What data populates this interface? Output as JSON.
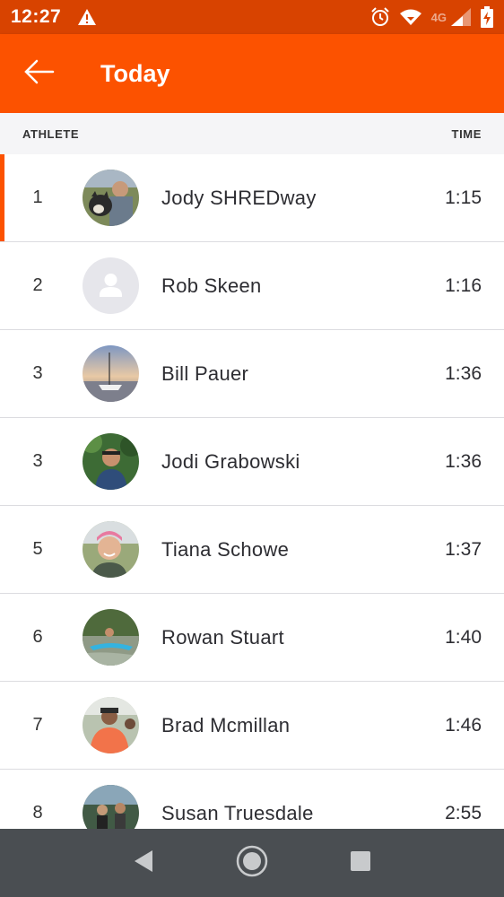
{
  "status_bar": {
    "time": "12:27",
    "network": "4G",
    "icons": [
      "warning-icon",
      "alarm-icon",
      "wifi-icon",
      "signal-icon",
      "battery-charging-icon"
    ]
  },
  "app_bar": {
    "title": "Today",
    "back_icon": "arrow-left-icon",
    "color": "#fc5200"
  },
  "list_header": {
    "athlete": "ATHLETE",
    "time": "TIME"
  },
  "athletes": [
    {
      "rank": "1",
      "name": "Jody SHREDway",
      "time": "1:15",
      "avatar": "photo-man-with-dog",
      "highlight": true
    },
    {
      "rank": "2",
      "name": "Rob Skeen",
      "time": "1:16",
      "avatar": "default-avatar-icon",
      "highlight": false
    },
    {
      "rank": "3",
      "name": "Bill Pauer",
      "time": "1:36",
      "avatar": "photo-sailboat",
      "highlight": false
    },
    {
      "rank": "3",
      "name": "Jodi Grabowski",
      "time": "1:36",
      "avatar": "photo-selfie-trees",
      "highlight": false
    },
    {
      "rank": "5",
      "name": "Tiana Schowe",
      "time": "1:37",
      "avatar": "photo-woman-smiling",
      "highlight": false
    },
    {
      "rank": "6",
      "name": "Rowan Stuart",
      "time": "1:40",
      "avatar": "photo-kayak",
      "highlight": false
    },
    {
      "rank": "7",
      "name": "Brad Mcmillan",
      "time": "1:46",
      "avatar": "photo-runner-orange",
      "highlight": false
    },
    {
      "rank": "8",
      "name": "Susan Truesdale",
      "time": "2:55",
      "avatar": "photo-cyclists",
      "highlight": false
    }
  ],
  "nav_bar": {
    "icons": [
      "back-triangle-icon",
      "home-circle-icon",
      "recents-square-icon"
    ]
  }
}
